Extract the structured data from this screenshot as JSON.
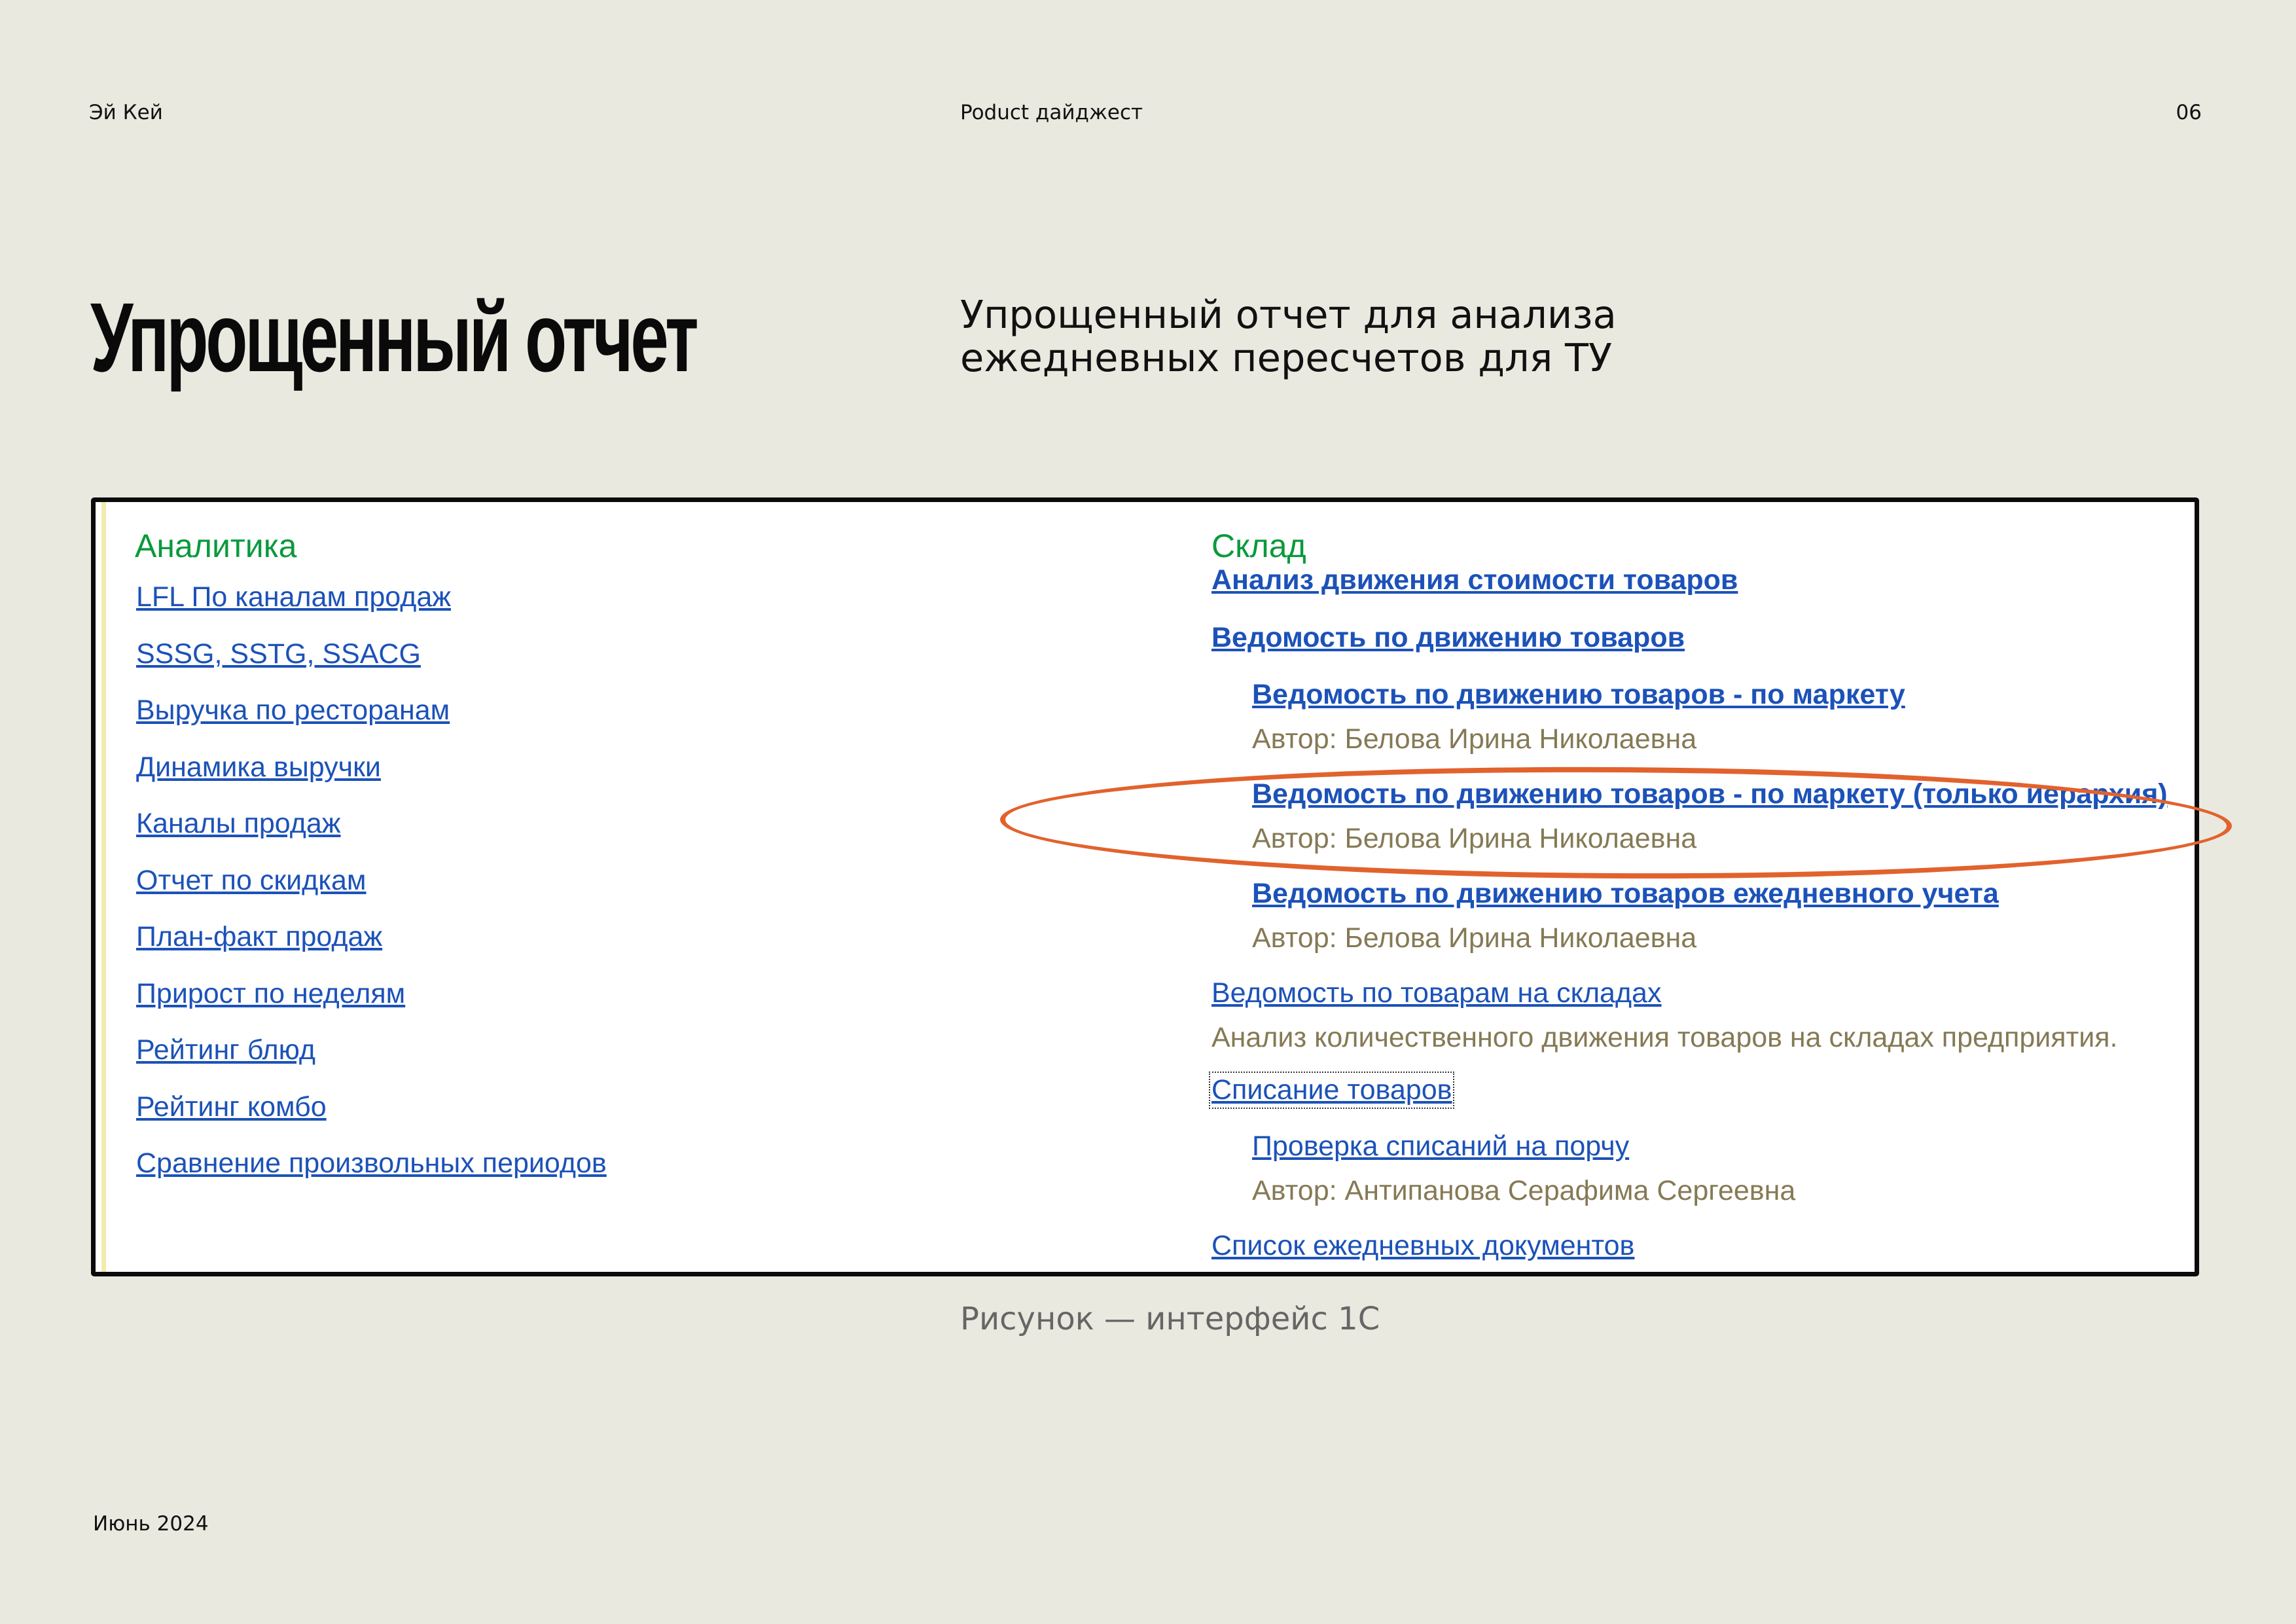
{
  "header": {
    "left": "Эй Кей",
    "center": "Poduct дайджест",
    "page_number": "06"
  },
  "title": "Упрощенный отчет",
  "subtitle_lines": [
    "Упрощенный отчет для анализа",
    "ежедневных пересчетов для ТУ"
  ],
  "screenshot": {
    "left_group": {
      "title": "Аналитика",
      "links": [
        "LFL По каналам продаж",
        "SSSG, SSTG, SSACG",
        "Выручка по ресторанам",
        "Динамика выручки",
        "Каналы продаж",
        "Отчет по скидкам",
        "План-факт продаж",
        "Прирост по неделям",
        "Рейтинг блюд",
        "Рейтинг комбо",
        "Сравнение произвольных периодов"
      ]
    },
    "right_group": {
      "title": "Склад",
      "items": [
        {
          "label": "Анализ движения стоимости товаров"
        },
        {
          "label": "Ведомость по движению товаров"
        },
        {
          "label": "Ведомость по движению товаров - по маркету",
          "author": "Автор: Белова Ирина Николаевна"
        },
        {
          "label": "Ведомость по движению товаров - по маркету (только иерархия)",
          "author": "Автор: Белова Ирина Николаевна"
        },
        {
          "label": "Ведомость по движению товаров ежедневного учета",
          "author": "Автор: Белова Ирина Николаевна"
        },
        {
          "label": "Ведомость по товарам на складах",
          "description": "Анализ количественного движения товаров на складах предприятия."
        },
        {
          "label": "Списание товаров"
        },
        {
          "label": "Проверка списаний на порчу",
          "author": "Автор: Антипанова Серафима Сергеевна"
        },
        {
          "label": "Список ежедневных документов"
        }
      ]
    },
    "highlight_color": "#e2622d",
    "link_color": "#1c52b8",
    "group_title_color": "#0a9a3c",
    "author_color": "#857a55"
  },
  "caption": "Рисунок — интерфейс 1С",
  "footer_date": "Июнь 2024"
}
